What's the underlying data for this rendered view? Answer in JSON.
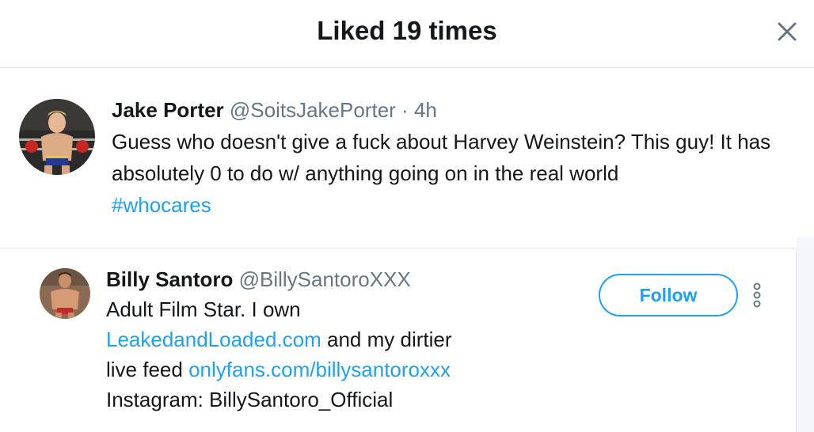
{
  "modal": {
    "title": "Liked 19 times",
    "close_icon": "close-icon"
  },
  "tweet": {
    "author_name": "Jake Porter",
    "author_handle": "@SoitsJakePorter",
    "separator": "·",
    "time": "4h",
    "text": "Guess who doesn't give a fuck about Harvey Weinstein? This guy! It has absolutely 0 to do w/ anything going on in the real world",
    "hashtag": "#whocares"
  },
  "users": [
    {
      "name": "Billy Santoro",
      "handle": "@BillySantoroXXX",
      "bio_line1": "Adult Film Star. I own",
      "bio_link1": "LeakedandLoaded.com",
      "bio_after_link1": " and my dirtier",
      "bio_line3_prefix": "live feed ",
      "bio_link2": "onlyfans.com/billysantoroxxx",
      "bio_line4": "Instagram: BillySantoro_Official",
      "follow_label": "Follow",
      "more_icon": "more-options-icon"
    }
  ],
  "colors": {
    "accent": "#1da1f2",
    "text_primary": "#14171a",
    "text_secondary": "#657786",
    "border": "#e1e8ed"
  }
}
